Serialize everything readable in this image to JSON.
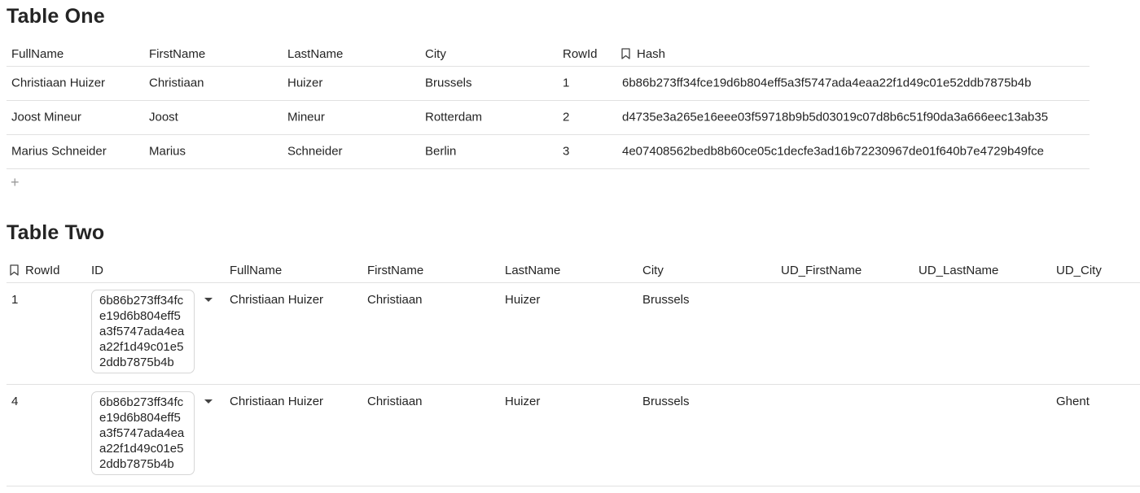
{
  "table_one": {
    "title": "Table One",
    "columns": [
      "FullName",
      "FirstName",
      "LastName",
      "City",
      "RowId",
      "Hash"
    ],
    "rows": [
      [
        "Christiaan Huizer",
        "Christiaan",
        "Huizer",
        "Brussels",
        "1",
        "6b86b273ff34fce19d6b804eff5a3f5747ada4eaa22f1d49c01e52ddb7875b4b"
      ],
      [
        "Joost Mineur",
        "Joost",
        "Mineur",
        "Rotterdam",
        "2",
        "d4735e3a265e16eee03f59718b9b5d03019c07d8b6c51f90da3a666eec13ab35"
      ],
      [
        "Marius Schneider",
        "Marius",
        "Schneider",
        "Berlin",
        "3",
        "4e07408562bedb8b60ce05c1decfe3ad16b72230967de01f640b7e4729b49fce"
      ]
    ],
    "add_row_label": "+"
  },
  "table_two": {
    "title": "Table Two",
    "columns": [
      "RowId",
      "ID",
      "FullName",
      "FirstName",
      "LastName",
      "City",
      "UD_FirstName",
      "UD_LastName",
      "UD_City"
    ],
    "rows": [
      {
        "RowId": "1",
        "ID_lines": [
          "6b86b273ff34fc",
          "e19d6b804eff5",
          "a3f5747ada4ea",
          "a22f1d49c01e5",
          "2ddb7875b4b"
        ],
        "FullName": "Christiaan Huizer",
        "FirstName": "Christiaan",
        "LastName": "Huizer",
        "City": "Brussels",
        "UD_FirstName": "",
        "UD_LastName": "",
        "UD_City": ""
      },
      {
        "RowId": "4",
        "ID_lines": [
          "6b86b273ff34fc",
          "e19d6b804eff5",
          "a3f5747ada4ea",
          "a22f1d49c01e5",
          "2ddb7875b4b"
        ],
        "FullName": "Christiaan Huizer",
        "FirstName": "Christiaan",
        "LastName": "Huizer",
        "City": "Brussels",
        "UD_FirstName": "",
        "UD_LastName": "",
        "UD_City": "Ghent"
      }
    ]
  },
  "icons": {
    "row_id_marker": "bookmark-icon",
    "reference_dropdown": "chevron-down-icon",
    "add_row": "plus-icon"
  }
}
